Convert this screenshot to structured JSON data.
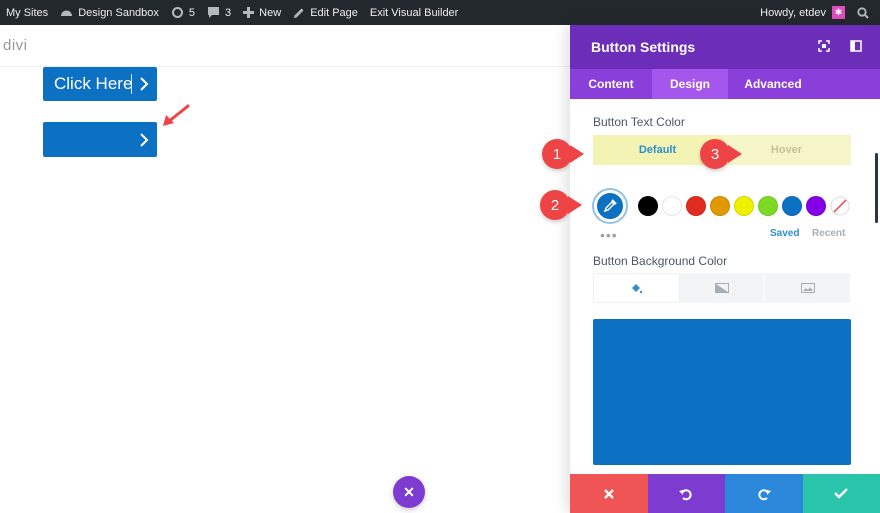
{
  "admin_bar": {
    "my_sites": "My Sites",
    "site_name": "Design Sandbox",
    "updates_count": "5",
    "comments_count": "3",
    "new_label": "New",
    "edit_page": "Edit Page",
    "exit_builder": "Exit Visual Builder",
    "howdy": "Howdy, etdev"
  },
  "page": {
    "logo": "divi",
    "button1_label": "Click Here",
    "button2_label": ""
  },
  "panel": {
    "title": "Button Settings",
    "tabs": [
      {
        "label": "Content",
        "active": false
      },
      {
        "label": "Design",
        "active": true
      },
      {
        "label": "Advanced",
        "active": false
      }
    ],
    "text_color_label": "Button Text Color",
    "states": [
      {
        "label": "Default",
        "active": true
      },
      {
        "label": "Hover",
        "active": false
      }
    ],
    "picker_color": "#0c71c3",
    "swatches": [
      "#000000",
      "#ffffff",
      "#e02b20",
      "#e09900",
      "#edf000",
      "#7cda24",
      "#0c71c3",
      "#8300e9",
      "none"
    ],
    "saved_label": "Saved",
    "recent_label": "Recent",
    "background_label": "Button Background Color",
    "background_color": "#0c71c3"
  },
  "annotations": [
    "1",
    "2",
    "3"
  ],
  "colors": {
    "panel_header": "#6c2eb9",
    "tabs_bg": "#8a3fdb",
    "footer_cancel": "#ef5555",
    "footer_undo": "#7e3bd0",
    "footer_redo": "#2b87da",
    "footer_save": "#29c4a9"
  }
}
